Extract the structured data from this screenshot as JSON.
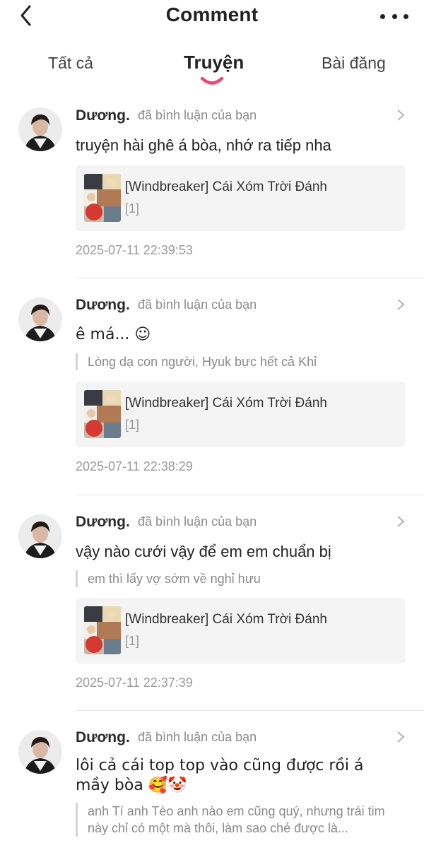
{
  "header": {
    "title": "Comment"
  },
  "tabs": [
    {
      "label": "Tất cả"
    },
    {
      "label": "Truyện",
      "active": true
    },
    {
      "label": "Bài đăng"
    }
  ],
  "colors": {
    "accent": "#f0466e",
    "card_bg": "#f4f4f4",
    "muted_text": "#8c8c8c"
  },
  "comments": [
    {
      "user": "Dương.",
      "action": "đã bình luận của bạn",
      "text": "truyện hài ghê á bòa, nhớ ra tiếp nha",
      "card_title": "[Windbreaker] Cái Xóm Trời Đánh",
      "card_chapter": "[1]",
      "time": "2025-07-11 22:39:53"
    },
    {
      "user": "Dương.",
      "action": "đã bình luận của bạn",
      "text": "ê má... ☺",
      "quote": "Lòng dạ con người, Hyuk bực hết cả Khỉ",
      "card_title": "[Windbreaker] Cái Xóm Trời Đánh",
      "card_chapter": "[1]",
      "time": "2025-07-11 22:38:29"
    },
    {
      "user": "Dương.",
      "action": "đã bình luận của bạn",
      "text": "vậy nào cưới vậy để em em chuẩn bị",
      "quote": "em thì lấy vợ sớm về nghỉ hưu",
      "card_title": "[Windbreaker] Cái Xóm Trời Đánh",
      "card_chapter": "[1]",
      "time": "2025-07-11 22:37:39"
    },
    {
      "user": "Dương.",
      "action": "đã bình luận của bạn",
      "text": "lôi cả cái top top vào cũng được rồi á mầy bòa 🥰🤡",
      "quote": "anh Tí anh Tèo anh nào em cũng quý, nhưng trái tim này chỉ có một mà thôi, làm sao chẻ được là..."
    }
  ]
}
